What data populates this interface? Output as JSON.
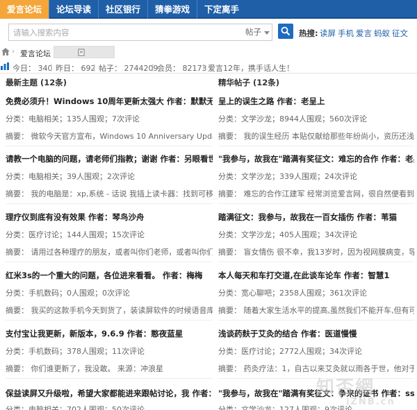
{
  "nav": {
    "tabs": [
      {
        "label": "爱言论坛"
      },
      {
        "label": "论坛导读"
      },
      {
        "label": "社区银行"
      },
      {
        "label": "猜拳游戏"
      },
      {
        "label": "下定离手"
      }
    ]
  },
  "search": {
    "placeholder": "请输入搜索内容",
    "type": "帖子",
    "hot_label": "热搜:",
    "hot": [
      "读屏",
      "手机",
      "爱言",
      "蚂蚁",
      "征文"
    ]
  },
  "breadcrumb": {
    "forum": "爱言论坛"
  },
  "stats": {
    "today": "今日： 340",
    "yesterday": "昨日： 692",
    "posts": "帖子： 2744209",
    "members": "会员： 82173",
    "welcome": "爱言12年，携手话人生！"
  },
  "columns": {
    "left_heading": "最新主题 (12条)",
    "right_heading": "精华帖子 (12条)"
  },
  "left_topics": [
    {
      "title": "免费必须升！Windows 10周年更新太强大 作者：默默无闻在",
      "meta": "分类：电脑相关；135人围观；7次评论",
      "summary": "摘要： 微软今天官方宣布，Windows 10 Anniversary Update一"
    },
    {
      "title": "请教一个电脑的问题，请老师们指教；谢谢 作者：另眼看世界",
      "meta": "分类：电脑相关；39人围观；2次评论",
      "summary": "摘要： 我的电脑是：xp,系统 - 话说 我插上读卡器：找到可移动"
    },
    {
      "title": "理疗仪到底有没有效果 作者：琴鸟沙舟",
      "meta": "分类：医疗讨论；144人围观；15次评论",
      "summary": "摘要： 请用过各种理疗的朋友，或者叫你们老师，或者叫你们思"
    },
    {
      "title": "红米3s的一个重大的问题，各位进来看看。 作者：梅梅",
      "meta": "分类：手机数码；0人围观；0次评论",
      "summary": "摘要： 我买的这款手机今天到货了，装读屏软件的时候语音库有"
    },
    {
      "title": "支付宝让我更新，新版本，9.6.9 作者：憨夜蓝星",
      "meta": "分类：手机数码；378人围观；11次评论",
      "summary": "摘要： 你们谁更新了，我没敢。 来源：冲浪星"
    },
    {
      "title": "保益读屏又升级啦，希望大家都能进来跟帖讨论，我 作者：师歌的小海",
      "meta": "分类：电脑相关；702人围观；50次评论",
      "summary": ""
    }
  ],
  "right_topics": [
    {
      "title": "呈上的误生之路 作者：老呈上",
      "meta": "分类：文学沙龙；8944人围观；560次评论",
      "summary": "摘要： 我的误生经历 本贴仅献给那些年纷尚小，资历还浅，"
    },
    {
      "title": "\"我参与，故我在\"踏满有奖征文：难忘的合作 作者：老兵",
      "meta": "分类：文学沙龙；339人围观；24次评论",
      "summary": "摘要： 难忘的合作江建军 经常浏览爱言网，很自然便看到了\""
    },
    {
      "title": "踏满征文：我参与，故我在一百女插伤 作者：苇猫",
      "meta": "分类：文学沙龙；405人围观；34次评论",
      "summary": "摘要： 盲女情伤 很不幸，我13岁时，因为视网膜病变，导致双"
    },
    {
      "title": "本人每天和车打交道,在此谈车论车 作者：智慧1",
      "meta": "分类：宽心聊吧；2358人围观；361次评论",
      "summary": "摘要： 随着大家生活水平的提高,虽然我们不能开车,但有可能给"
    },
    {
      "title": "浅谈药麸于艾灸的结合 作者：医道慢慢",
      "meta": "分类：医疗讨论；2772人围观；34次评论",
      "summary": "摘要： 药灸疗法：1，自古以来艾灸就以雨各于世，他对于内科"
    },
    {
      "title": "\"我参与，故我在\"踏满有奖征文：争来的证书 作者：ssx遥望",
      "meta": "分类：文学沙龙；127人围观；9次评论",
      "summary": ""
    }
  ],
  "watermark": {
    "main": "知否網",
    "sub": "iZNB.cn"
  }
}
